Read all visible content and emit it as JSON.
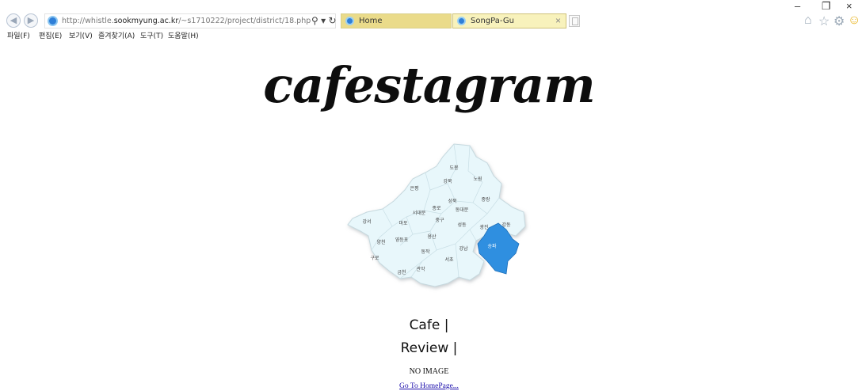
{
  "browser": {
    "url_prefix": "http://whistle.",
    "url_domain": "sookmyung.ac.kr",
    "url_path": "/~s1710222/project/district/18.php",
    "address_tools": "⚲ ▾ ↻",
    "tabs": [
      {
        "label": "Home",
        "active": false
      },
      {
        "label": "SongPa-Gu",
        "active": true
      }
    ],
    "tab_close": "×",
    "menu": [
      "파일(F)",
      "편집(E)",
      "보기(V)",
      "즐겨찾기(A)",
      "도구(T)",
      "도움말(H)"
    ],
    "window_controls": {
      "minimize": "–",
      "restore": "❐",
      "close": "×"
    },
    "toolbar_icons": [
      "home-icon",
      "star-icon",
      "gear-icon",
      "smiley-icon"
    ]
  },
  "page": {
    "logo": "cafestagram",
    "cafe_label": "Cafe |",
    "review_label": "Review |",
    "no_image": "NO IMAGE",
    "home_link": "Go To HomePage..."
  },
  "map": {
    "highlighted": "송파",
    "highlight_color": "#2f8fe0",
    "base_color": "#e8f7fb",
    "labels": [
      "도봉",
      "강북",
      "노원",
      "은평",
      "성북",
      "중랑",
      "종로",
      "동대문",
      "서대문",
      "강서",
      "마포",
      "중구",
      "성동",
      "광진",
      "강동",
      "용산",
      "양천",
      "영등포",
      "동작",
      "강남",
      "송파",
      "구로",
      "서초",
      "금천",
      "관악"
    ]
  }
}
